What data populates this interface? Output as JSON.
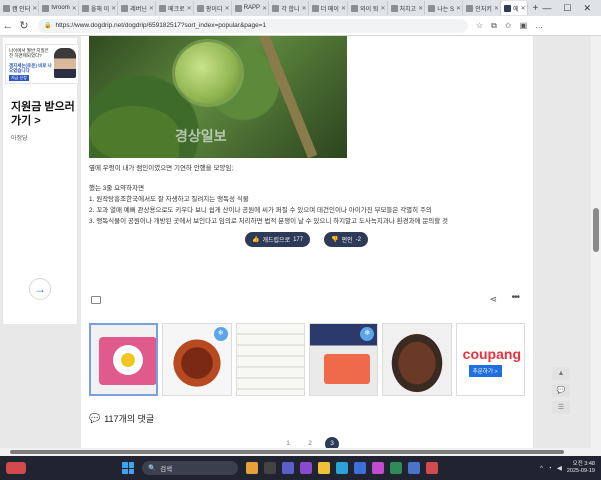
{
  "browser": {
    "tabs": [
      {
        "label": "캠 인터"
      },
      {
        "label": "tvroom"
      },
      {
        "label": "올해 이"
      },
      {
        "label": "레버닌"
      },
      {
        "label": "메크로"
      },
      {
        "label": "팡이디"
      },
      {
        "label": "RAPP"
      },
      {
        "label": "각 합니"
      },
      {
        "label": "더 메이"
      },
      {
        "label": "와이 퇴"
      },
      {
        "label": "처치고"
      },
      {
        "label": "나는 S"
      },
      {
        "label": "인처키"
      },
      {
        "label": "에"
      }
    ],
    "url": "https://www.dogdrip.net/dogdrip/659182517?sort_index=popular&page=1"
  },
  "left_ad": {
    "banner_line1": "나이에서 월반 치질은 전 하면제되었다?",
    "banner_line2": "겜지세는(로운) 비로 나오였습니다",
    "banner_button": "지금 신청",
    "title": "지원금 받으러 가기 >",
    "sub": "아정당"
  },
  "post": {
    "photo_watermark": "경상일보",
    "caption": "옆에 우렁이 내가 램인이였으면 기연하 안했을 모양임;",
    "lines": [
      "했는 3줄 요약하자면",
      "1. 원작탕흥조한국에서도 잘 자생하고 질려지는 맹독성 식물",
      "2. 꼬과 열매 예뻐 관상용으로도 키우다 보니 쉽게 산이나 공원에 씨가 퍼질 수 있으며 데건인이나 아이가진 부모들은 각별히 주의",
      "3. 맹독식물이 공원이나 개방된 곳에서 보인다고 임의로 처리하면 법적 분쟁이 날 수 있으니 하지말고 도사녹지과나 환경과에 문의할 것"
    ],
    "upvote_label": "개드립으로",
    "upvote_count": "177",
    "downvote_label": "펀인",
    "downvote_count": "-2"
  },
  "ads": {
    "badge": "❄",
    "coupang_logo": "coupang",
    "coupang_cta": "추문하기 >"
  },
  "comments": {
    "label": "117개의 댓글"
  },
  "pagination": [
    "1",
    "2",
    "3"
  ],
  "taskbar": {
    "search_placeholder": "검색",
    "time": "오전 3:48",
    "date": "2025-09-19"
  }
}
